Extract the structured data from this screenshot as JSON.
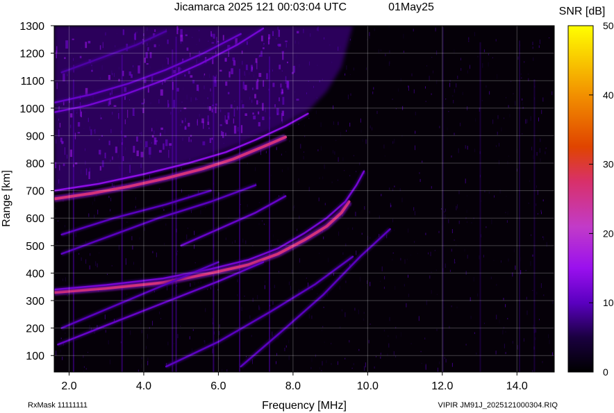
{
  "chart_data": {
    "type": "heatmap",
    "title": "Jicamarca 2025 121 00:03:04 UTC",
    "date_label": "01May25",
    "xlabel": "Frequency [MHz]",
    "ylabel": "Range [km]",
    "xlim": [
      1.6,
      15.0
    ],
    "ylim": [
      40,
      1300
    ],
    "x_ticks": [
      2.0,
      4.0,
      6.0,
      8.0,
      10.0,
      12.0,
      14.0
    ],
    "x_tick_labels": [
      "2.0",
      "4.0",
      "6.0",
      "8.0",
      "10.0",
      "12.0",
      "14.0"
    ],
    "y_ticks": [
      100,
      200,
      300,
      400,
      500,
      600,
      700,
      800,
      900,
      1000,
      1100,
      1200,
      1300
    ],
    "y_tick_labels": [
      "100",
      "200",
      "300",
      "400",
      "500",
      "600",
      "700",
      "800",
      "900",
      "1000",
      "1100",
      "1200",
      "1300"
    ],
    "grid": true,
    "colorbar": {
      "label": "SNR [dB]",
      "range": [
        0,
        50
      ],
      "ticks": [
        0,
        10,
        20,
        30,
        40,
        50
      ],
      "tick_labels": [
        "0",
        "10",
        "20",
        "30",
        "40",
        "50"
      ],
      "colors": [
        "#000000",
        "#3a0070",
        "#8a00ff",
        "#c23bc8",
        "#e04400",
        "#f2a000",
        "#ffff00"
      ]
    },
    "traces": [
      {
        "name": "O-mode 1st hop",
        "snr_db": 26,
        "points": [
          [
            1.6,
            330
          ],
          [
            3.0,
            345
          ],
          [
            4.5,
            365
          ],
          [
            5.8,
            400
          ],
          [
            6.8,
            430
          ],
          [
            7.6,
            470
          ],
          [
            8.3,
            520
          ],
          [
            8.9,
            570
          ],
          [
            9.3,
            620
          ],
          [
            9.5,
            660
          ]
        ]
      },
      {
        "name": "X-mode 1st hop",
        "snr_db": 12,
        "points": [
          [
            1.6,
            340
          ],
          [
            3.0,
            357
          ],
          [
            4.5,
            380
          ],
          [
            5.8,
            415
          ],
          [
            6.8,
            448
          ],
          [
            7.6,
            490
          ],
          [
            8.3,
            545
          ],
          [
            8.9,
            600
          ],
          [
            9.4,
            660
          ],
          [
            9.7,
            720
          ],
          [
            9.9,
            770
          ]
        ]
      },
      {
        "name": "2nd hop",
        "snr_db": 26,
        "points": [
          [
            1.6,
            670
          ],
          [
            2.6,
            690
          ],
          [
            3.6,
            715
          ],
          [
            4.6,
            745
          ],
          [
            5.6,
            780
          ],
          [
            6.4,
            815
          ],
          [
            7.2,
            860
          ],
          [
            7.8,
            895
          ]
        ]
      },
      {
        "name": "2nd hop upper",
        "snr_db": 14,
        "points": [
          [
            1.6,
            700
          ],
          [
            2.8,
            725
          ],
          [
            4.0,
            760
          ],
          [
            5.2,
            800
          ],
          [
            6.2,
            840
          ],
          [
            7.0,
            885
          ],
          [
            7.8,
            935
          ],
          [
            8.4,
            980
          ]
        ]
      },
      {
        "name": "3rd hop",
        "snr_db": 12,
        "points": [
          [
            1.6,
            985
          ],
          [
            2.5,
            1010
          ],
          [
            3.5,
            1050
          ],
          [
            4.5,
            1100
          ],
          [
            5.5,
            1160
          ],
          [
            6.5,
            1230
          ],
          [
            7.2,
            1290
          ]
        ]
      },
      {
        "name": "3rd hop lower",
        "snr_db": 11,
        "points": [
          [
            1.6,
            1020
          ],
          [
            2.6,
            1050
          ],
          [
            3.6,
            1090
          ],
          [
            4.6,
            1140
          ],
          [
            5.6,
            1200
          ],
          [
            6.6,
            1270
          ]
        ]
      },
      {
        "name": "oblique 1",
        "snr_db": 11,
        "points": [
          [
            1.7,
            140
          ],
          [
            3.0,
            210
          ],
          [
            4.5,
            290
          ],
          [
            6.0,
            370
          ],
          [
            7.2,
            440
          ]
        ]
      },
      {
        "name": "oblique 2",
        "snr_db": 10,
        "points": [
          [
            1.8,
            200
          ],
          [
            3.2,
            280
          ],
          [
            4.6,
            360
          ],
          [
            6.0,
            440
          ]
        ]
      },
      {
        "name": "oblique 3",
        "snr_db": 10,
        "points": [
          [
            1.8,
            470
          ],
          [
            3.0,
            530
          ],
          [
            4.4,
            600
          ],
          [
            5.8,
            660
          ],
          [
            7.0,
            720
          ]
        ]
      },
      {
        "name": "oblique 4",
        "snr_db": 10,
        "points": [
          [
            1.8,
            540
          ],
          [
            3.2,
            600
          ],
          [
            4.6,
            650
          ],
          [
            5.8,
            700
          ]
        ]
      },
      {
        "name": "oblique 5",
        "snr_db": 11,
        "points": [
          [
            5.0,
            500
          ],
          [
            6.0,
            560
          ],
          [
            7.0,
            620
          ],
          [
            7.8,
            680
          ]
        ]
      },
      {
        "name": "oblique 6",
        "snr_db": 10,
        "points": [
          [
            4.6,
            60
          ],
          [
            6.0,
            150
          ],
          [
            7.4,
            260
          ],
          [
            8.6,
            360
          ],
          [
            9.6,
            460
          ]
        ]
      },
      {
        "name": "oblique 7",
        "snr_db": 10,
        "points": [
          [
            6.6,
            60
          ],
          [
            7.8,
            200
          ],
          [
            8.8,
            320
          ],
          [
            9.8,
            460
          ],
          [
            10.6,
            560
          ]
        ]
      },
      {
        "name": "faint upper-left",
        "snr_db": 9,
        "points": [
          [
            1.8,
            1130
          ],
          [
            2.8,
            1180
          ],
          [
            3.8,
            1230
          ],
          [
            4.6,
            1280
          ]
        ]
      }
    ],
    "noise_columns_mhz": [
      2.1,
      3.4,
      4.75,
      4.85,
      5.85,
      6.55,
      7.35,
      12.0,
      13.0,
      14.05,
      14.45
    ]
  },
  "footer": {
    "left": "RxMask 11111111",
    "right": "VIPIR  JM91J_2025121000304.RIQ"
  }
}
